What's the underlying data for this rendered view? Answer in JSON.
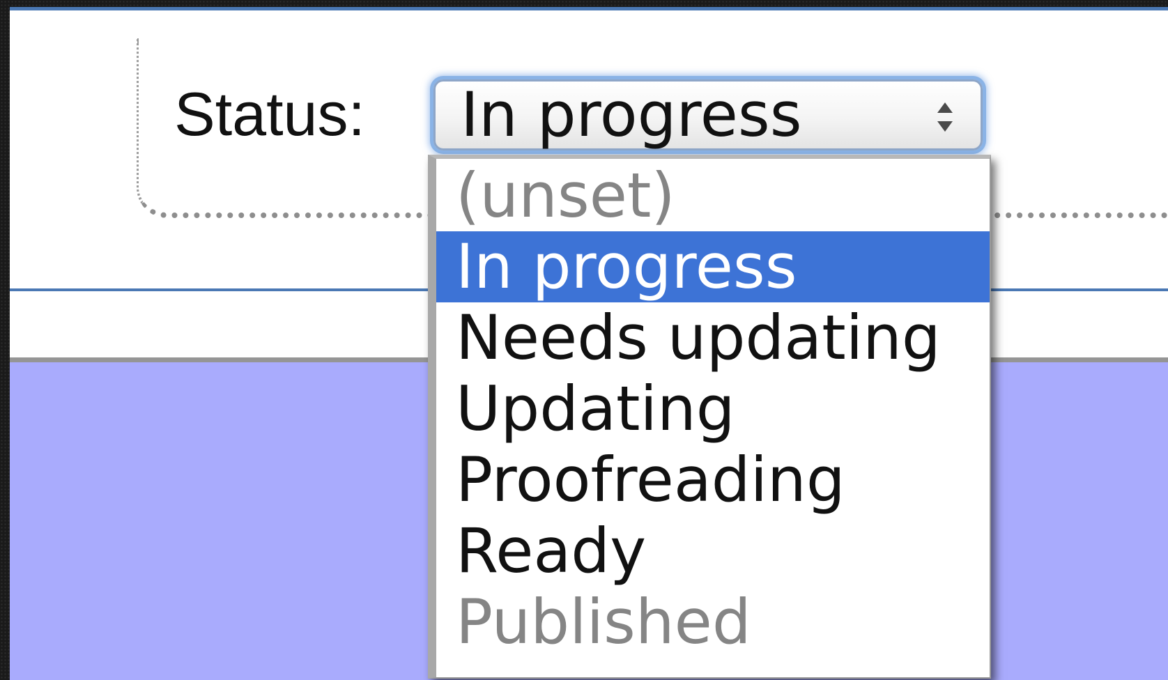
{
  "form": {
    "status_label": "Status:",
    "status_select": {
      "current_value": "In progress",
      "icon": "up-down-stepper-icon",
      "options": [
        {
          "label": "(unset)",
          "disabled": true,
          "selected": false
        },
        {
          "label": "In progress",
          "disabled": false,
          "selected": true
        },
        {
          "label": "Needs updating",
          "disabled": false,
          "selected": false
        },
        {
          "label": "Updating",
          "disabled": false,
          "selected": false
        },
        {
          "label": "Proofreading",
          "disabled": false,
          "selected": false
        },
        {
          "label": "Ready",
          "disabled": false,
          "selected": false
        },
        {
          "label": "Published",
          "disabled": true,
          "selected": false
        }
      ]
    }
  },
  "colors": {
    "selection_highlight": "#3d73d6",
    "focus_ring": "#8ab3e6",
    "rule_blue": "#4a78b4",
    "content_background": "#a9abfd",
    "disabled_text": "#858585"
  }
}
